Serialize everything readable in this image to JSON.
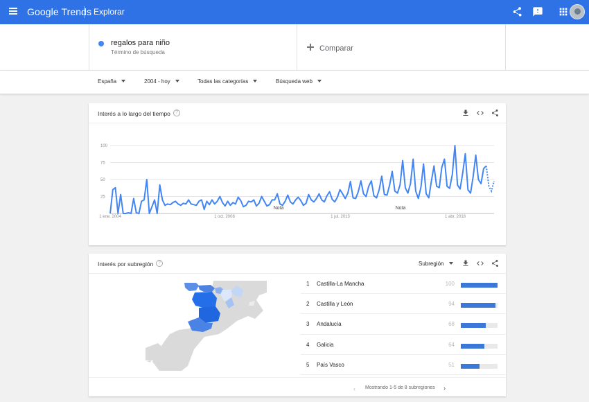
{
  "app": {
    "brand": "Google Trends",
    "section": "Explorar"
  },
  "search": {
    "term": "regalos para niño",
    "term_type": "Término de búsqueda",
    "term_color": "#4285f4",
    "compare_label": "Comparar"
  },
  "filters": [
    {
      "label": "España"
    },
    {
      "label": "2004 - hoy"
    },
    {
      "label": "Todas las categorías"
    },
    {
      "label": "Búsqueda web"
    }
  ],
  "interest_over_time": {
    "title": "Interés a lo largo del tiempo",
    "help": "?",
    "notes": [
      "Nota",
      "Nota"
    ]
  },
  "chart_data": {
    "type": "line",
    "title": "Interés a lo largo del tiempo",
    "xlabel": "",
    "ylabel": "",
    "x_tick_labels": [
      "1 ene. 2004",
      "1 oct. 2008",
      "1 jul. 2013",
      "1 abr. 2018"
    ],
    "y_ticks": [
      100,
      75,
      50,
      25
    ],
    "ylim": [
      0,
      100
    ],
    "grid": true,
    "series": [
      {
        "color": "#4285f4",
        "values": [
          0,
          35,
          38,
          0,
          28,
          0,
          0,
          1,
          0,
          22,
          1,
          0,
          18,
          20,
          50,
          0,
          10,
          20,
          0,
          42,
          20,
          12,
          14,
          13,
          16,
          18,
          14,
          12,
          15,
          14,
          20,
          14,
          13,
          12,
          18,
          20,
          6,
          18,
          13,
          20,
          14,
          18,
          25,
          16,
          11,
          18,
          12,
          16,
          14,
          24,
          19,
          10,
          12,
          18,
          17,
          20,
          11,
          15,
          25,
          18,
          11,
          13,
          20,
          20,
          29,
          14,
          12,
          18,
          27,
          17,
          14,
          20,
          24,
          19,
          12,
          15,
          28,
          20,
          17,
          22,
          29,
          20,
          17,
          26,
          32,
          21,
          17,
          24,
          35,
          29,
          22,
          30,
          47,
          23,
          22,
          32,
          48,
          29,
          25,
          40,
          48,
          26,
          23,
          35,
          55,
          28,
          27,
          42,
          62,
          33,
          30,
          42,
          78,
          38,
          30,
          44,
          80,
          33,
          22,
          39,
          73,
          29,
          23,
          48,
          70,
          40,
          38,
          68,
          80,
          40,
          37,
          57,
          100,
          42,
          36,
          60,
          88,
          35,
          30,
          55,
          86,
          50,
          44,
          66,
          70,
          40,
          33,
          48
        ]
      }
    ]
  },
  "interest_by_subregion": {
    "title": "Interés por subregión",
    "help": "?",
    "select_label": "Subregión",
    "rows": [
      {
        "rank": "1",
        "name": "Castilla-La Mancha",
        "score": "100",
        "value": 100
      },
      {
        "rank": "2",
        "name": "Castilla y León",
        "score": "94",
        "value": 94
      },
      {
        "rank": "3",
        "name": "Andalucía",
        "score": "68",
        "value": 68
      },
      {
        "rank": "4",
        "name": "Galicia",
        "score": "64",
        "value": 64
      },
      {
        "rank": "5",
        "name": "País Vasco",
        "score": "51",
        "value": 51
      }
    ],
    "footer": "Mostrando 1-5 de 8 subregiones"
  },
  "icons": {
    "menu": "menu-icon",
    "share": "share-icon",
    "feedback": "feedback-icon",
    "apps": "apps-icon",
    "download": "download-icon",
    "embed": "embed-icon"
  }
}
